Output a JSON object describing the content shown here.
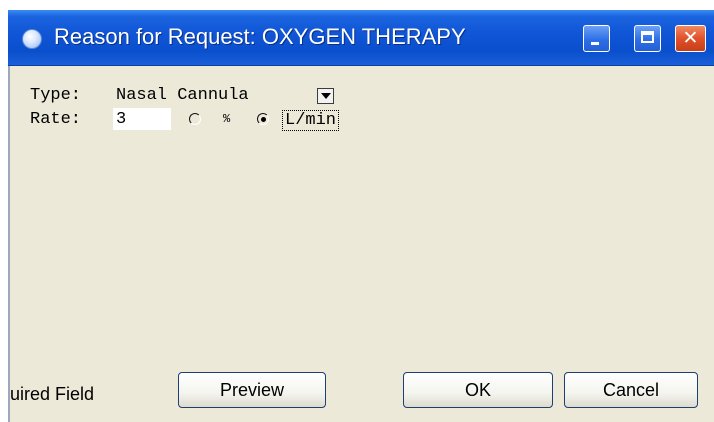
{
  "window": {
    "title": "Reason for Request: OXYGEN THERAPY"
  },
  "title_buttons": {
    "minimize_icon": "minimize-icon",
    "maximize_icon": "maximize-icon",
    "close_icon": "close-icon",
    "close_glyph": "✕"
  },
  "form": {
    "type_label": "Type:",
    "type_value": "Nasal Cannula",
    "rate_label": "Rate:",
    "rate_value": "3",
    "unit_percent_label": "%",
    "unit_lmin_label": "L/min",
    "selected_unit": "L/min"
  },
  "footer": {
    "status_text": "uired Field",
    "preview_label": "Preview",
    "ok_label": "OK",
    "cancel_label": "Cancel"
  },
  "colors": {
    "titlebar": "#0f55d6",
    "window_bg": "#ece9d8",
    "close_button": "#e0522a"
  }
}
